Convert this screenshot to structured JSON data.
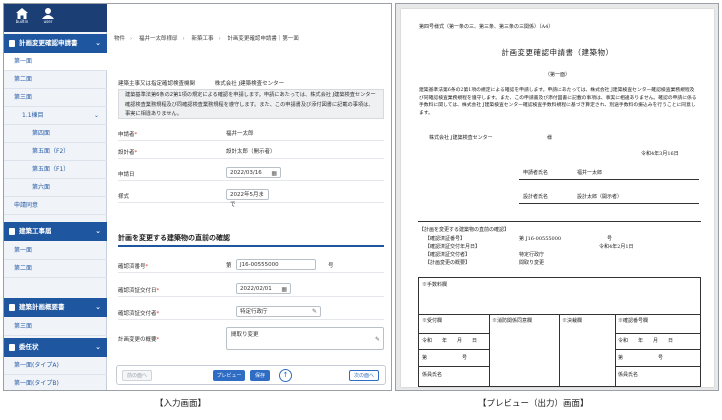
{
  "sidebar": {
    "top_icons": [
      {
        "icon": "home-icon",
        "label": "builtin"
      },
      {
        "icon": "user-icon",
        "label": "user"
      }
    ],
    "sections": [
      {
        "label": "計画変更確認申請書"
      },
      {
        "label": "建築工事届"
      },
      {
        "label": "建築計画概要書"
      },
      {
        "label": "委任状"
      }
    ],
    "items": {
      "s1": [
        "第一面",
        "第二面",
        "第三面",
        "1.1棟目",
        "第四面",
        "第五面（F2）",
        "第五面（F1）",
        "第六面",
        "申請同意"
      ],
      "s2": [
        "第一面",
        "第二面"
      ],
      "s3": [
        "第三面"
      ],
      "s4": [
        "第一面(タイプA)",
        "第一面(タイプB)"
      ]
    }
  },
  "breadcrumb": [
    "物件",
    "福井一太郎様邸",
    "新築工事",
    "計画変更確認申請書｜第一面"
  ],
  "form": {
    "applicant_label": "建築主事又は指定確認検査機関",
    "applicant_value": "株式会社 J建築検査センター",
    "notice": "建築基準法第6条の2第1項の規定による確認を申請します。申請にあたっては、株式会社 J建築検査センター確認検査業務規程及び同確認検査業務規程を遵守します。また、この申請書及び添付図書に記載の事項は、事実に相違ありません。",
    "rows": [
      {
        "label": "申請者",
        "required": true,
        "value": "福井一太郎"
      },
      {
        "label": "設計者",
        "required": true,
        "value": "設計太郎（開示者）"
      },
      {
        "label": "申請日",
        "required": false,
        "value": "2022/03/16"
      },
      {
        "label": "様式",
        "required": false,
        "value": "2022年5月まで"
      }
    ],
    "section_title": "計画を変更する建築物の直前の確認",
    "confirm_rows": [
      {
        "label": "確認済番号",
        "required": true,
        "prefix": "第",
        "value": "J16-00555000",
        "suffix": "号"
      },
      {
        "label": "確認済証交付日",
        "required": true,
        "value": "2022/02/01"
      },
      {
        "label": "確認済証交付者",
        "required": true,
        "value": "特定行政庁"
      },
      {
        "label": "計画変更の概要",
        "required": true,
        "value": "間取り変更"
      }
    ]
  },
  "footer": {
    "prev": "前の面へ",
    "preview": "プレビュー",
    "save": "保存",
    "up": "↑",
    "next": "次の面へ"
  },
  "captions": {
    "left": "【入力画面】",
    "right": "【プレビュー（出力）画面】"
  },
  "preview": {
    "form_no": "第四号様式（第一条の三、第三条、第三条の三関係）（A4）",
    "title": "計画変更確認申請書（建築物）",
    "page_label": "（第一面）",
    "body": "建築基準法第6条の2第1項の規定による確認を申請します。申請にあたっては、株式会社 J建築検査センター確認検査業務規程及び同確認検査業務規程を遵守します。また、この申請書及び添付図書に記載の事項は、事実に相違ありません。確認の申請に係る手数料に関しては、株式会社 J建築検査センター確認検査手数料規程に基づき算定され、別途手数料の振込みを行うことに同意します。",
    "to": "株式会社 J建築検査センター",
    "sama": "様",
    "date": "令和4年3月16日",
    "applicant_label": "申請者氏名",
    "applicant_value": "福井一太郎",
    "designer_label": "設計者氏名",
    "designer_value": "設計太郎（開示者）",
    "prev_section": "【計画を変更する建築物の直前の確認】",
    "prev_rows": [
      {
        "label": "【確認済証番号】",
        "value": "第 J16-00555000",
        "suffix": "号"
      },
      {
        "label": "【確認済証交付年月日】",
        "value": "令和4年2月1日"
      },
      {
        "label": "【確認済証交付者】",
        "value": "特定行政庁"
      },
      {
        "label": "【計画変更の概要】",
        "value": "間取り変更"
      }
    ],
    "table": {
      "fee": "※手数料欄",
      "c1": "※受付欄",
      "c2": "※消防関係同意欄",
      "c3": "※決裁欄",
      "c4": "※確認番号欄",
      "date1": "令和　　年　　月　　日",
      "date2": "令和　　年　　月　　日",
      "no1": "第　　　　　　　号",
      "no2": "第　　　　　　　号",
      "staff1": "係員氏名",
      "staff2": "係員氏名"
    }
  }
}
